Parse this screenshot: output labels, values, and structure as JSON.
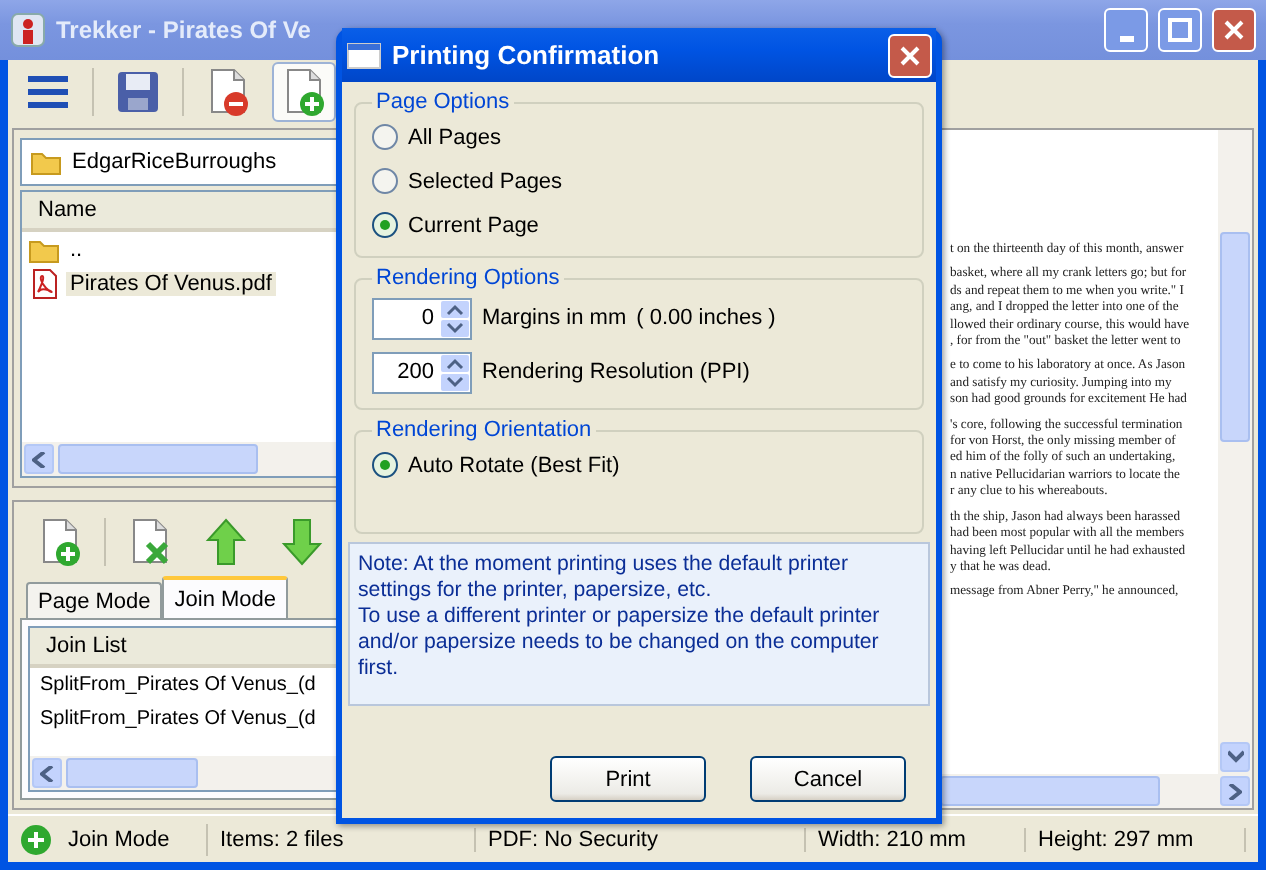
{
  "window": {
    "title": "Trekker - Pirates Of Ve"
  },
  "toolbar": {
    "buttons": [
      {
        "kind": "menu",
        "pressed": false
      },
      {
        "kind": "save",
        "pressed": false
      },
      {
        "kind": "remove",
        "pressed": false
      },
      {
        "kind": "add",
        "pressed": true
      }
    ]
  },
  "browser": {
    "path": "EdgarRiceBurroughs",
    "column": "Name",
    "items": [
      {
        "kind": "folder",
        "name": "..",
        "selected": false
      },
      {
        "kind": "pdf",
        "name": "Pirates Of Venus.pdf",
        "selected": true
      }
    ]
  },
  "join_panel": {
    "tools": [
      {
        "kind": "add"
      },
      {
        "kind": "remove"
      },
      {
        "kind": "up"
      },
      {
        "kind": "down"
      }
    ],
    "tabs": [
      {
        "label": "Page Mode",
        "selected": false
      },
      {
        "label": "Join Mode",
        "selected": true
      }
    ],
    "column": "Join List",
    "items": [
      "SplitFrom_Pirates Of Venus_(d",
      "SplitFrom_Pirates Of Venus_(d"
    ]
  },
  "document": {
    "paragraphs": [
      [
        "t on the thirteenth day of this month, answer"
      ],
      [
        "basket, where all my crank letters go; but for",
        "ds and repeat them to me when you write.\" I",
        "ang, and I dropped the letter into one of the",
        "llowed their ordinary course, this would have",
        ", for from the \"out\" basket the letter went to"
      ],
      [
        "e to come to his laboratory at once. As Jason",
        "and satisfy my curiosity. Jumping into my",
        "son had good grounds for excitement He had"
      ],
      [
        "'s core, following the successful termination",
        "for von Horst, the only missing member of",
        "ed him of the folly of such an undertaking,",
        "n native Pellucidarian warriors to locate the",
        "r any clue to his whereabouts."
      ],
      [
        "th the ship, Jason had always been harassed",
        "had been most popular with all the members",
        "having left Pellucidar until he had exhausted",
        "y that he was dead."
      ],
      [
        "message from Abner Perry,\" he announced,"
      ]
    ]
  },
  "dialog": {
    "title": "Printing Confirmation",
    "page_options": {
      "legend": "Page Options",
      "options": [
        {
          "label": "All Pages",
          "selected": false
        },
        {
          "label": "Selected Pages",
          "selected": false
        },
        {
          "label": "Current Page",
          "selected": true
        }
      ]
    },
    "rendering_options": {
      "legend": "Rendering Options",
      "margins": {
        "value": "0",
        "label": "Margins in mm",
        "note": "( 0.00 inches )"
      },
      "resolution": {
        "value": "200",
        "label": "Rendering Resolution (PPI)"
      }
    },
    "orientation": {
      "legend": "Rendering Orientation",
      "options": [
        {
          "label": "Auto Rotate (Best Fit)",
          "selected": true
        }
      ]
    },
    "note": "Note: At the moment printing uses the default printer settings for the printer, papersize, etc.\nTo use a different printer or papersize the default printer and/or papersize needs to be changed on the computer first.",
    "buttons": [
      "Print",
      "Cancel"
    ]
  },
  "status_bar": {
    "mode": "Join Mode",
    "cells": [
      "Items: 2 files",
      "PDF: No Security",
      "Width: 210 mm",
      "Height: 297 mm"
    ]
  }
}
